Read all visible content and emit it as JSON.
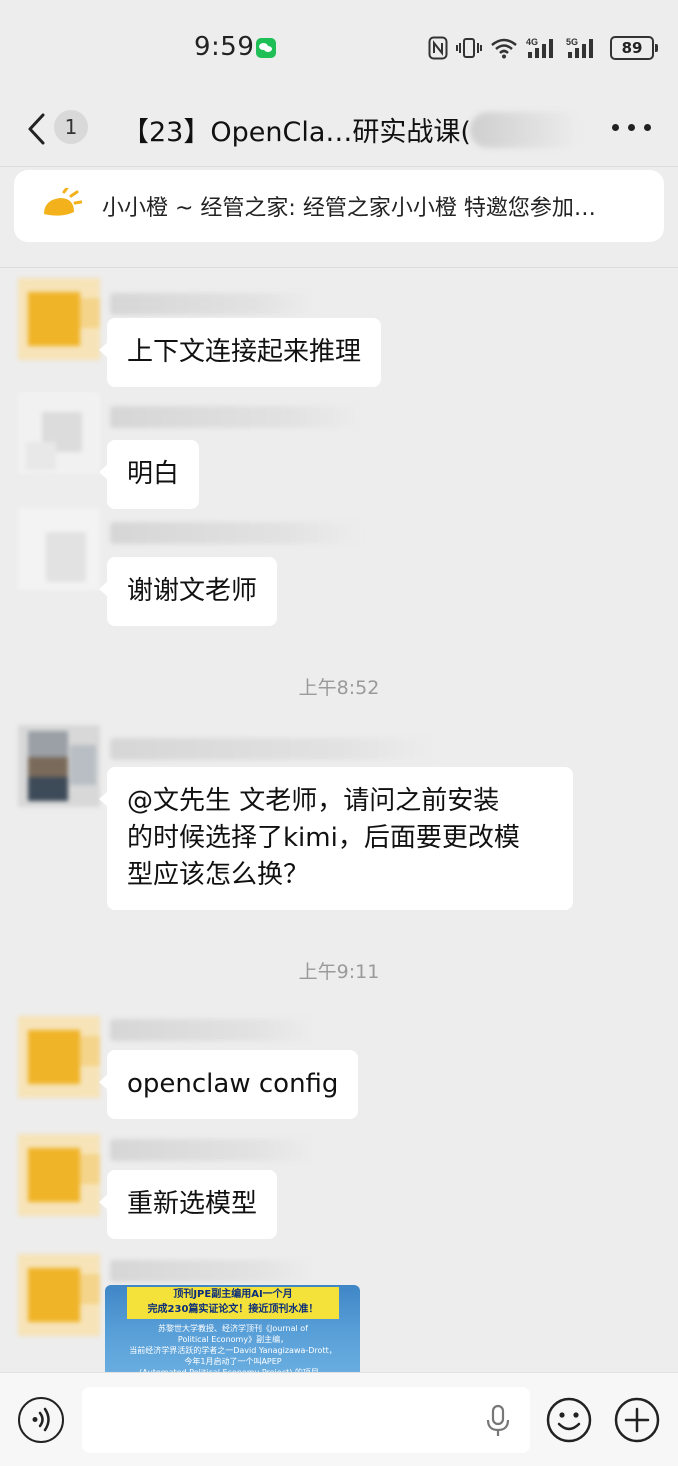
{
  "status_bar": {
    "time": "9:59",
    "battery": "89",
    "network_4g": "4G",
    "network_5g": "5G"
  },
  "header": {
    "back_icon": "chevron-left-icon",
    "unread_count": "1",
    "title": "【23】OpenCla…研实战课(",
    "more_icon": "more-dots-icon"
  },
  "notice": {
    "icon": "megaphone-icon",
    "text": "小小橙 ~ 经管之家: 经管之家小小橙 特邀您参加…"
  },
  "messages": [
    {
      "type": "text",
      "text": "上下文连接起来推理",
      "avatar_color": "#f0b429"
    },
    {
      "type": "text",
      "text": "明白",
      "avatar_color": "#e6e6e6"
    },
    {
      "type": "text",
      "text": "谢谢文老师",
      "avatar_color": "#e8e8e8"
    },
    {
      "type": "time",
      "text": "上午8:52"
    },
    {
      "type": "text",
      "text": "@文先生  文老师，请问之前安装\n的时候选择了kimi，后面要更改模\n型应该怎么换？",
      "avatar_color": "#8a8f96"
    },
    {
      "type": "time",
      "text": "上午9:11"
    },
    {
      "type": "text",
      "text": "openclaw config",
      "avatar_color": "#f0b429"
    },
    {
      "type": "text",
      "text": "重新选模型",
      "avatar_color": "#f0b429"
    },
    {
      "type": "image",
      "avatar_color": "#f0b429",
      "headline": "顶刊JPE副主编用AI一个月\n完成230篇实证论文！接近顶刊水准！",
      "body": "苏黎世大学教授、经济学顶刊《Journal of\nPolitical Economy》副主编，\n当前经济学界活跃的学者之一David Yanagizawa-Drott，\n今年1月启动了一个叫APEP\n(Automated Political Economy Project) 的项目。"
    }
  ],
  "input_bar": {
    "voice_icon": "voice-icon",
    "mic_icon": "microphone-icon",
    "emoji_icon": "emoji-icon",
    "plus_icon": "plus-icon"
  }
}
